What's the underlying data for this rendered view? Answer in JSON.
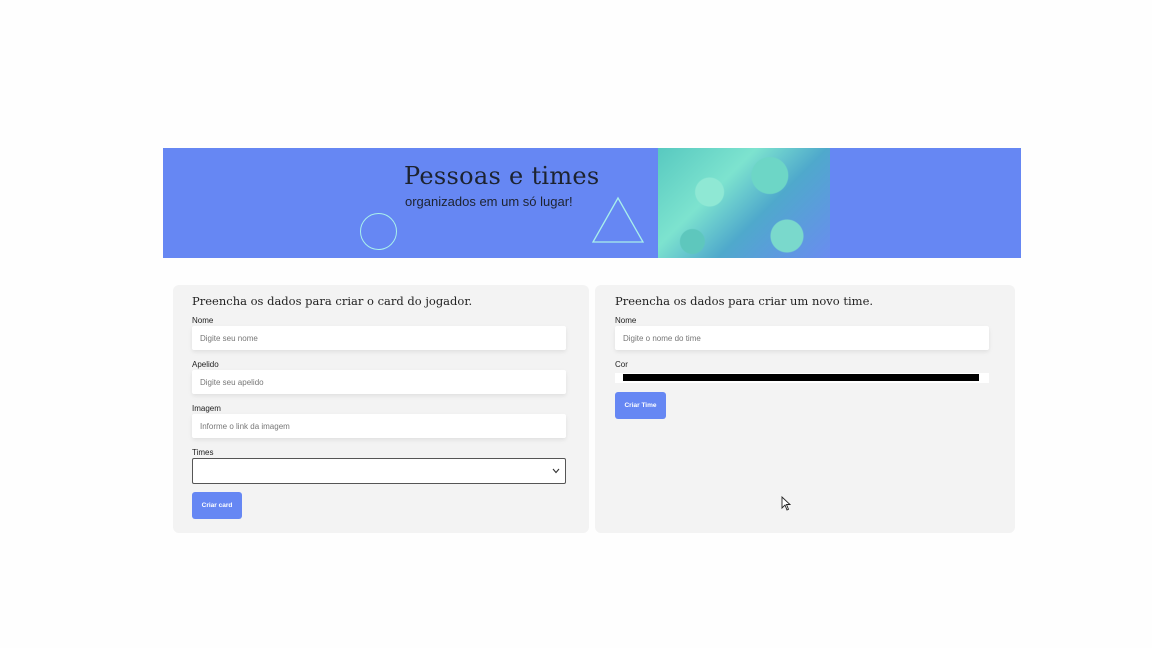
{
  "banner": {
    "title": "Pessoas e times",
    "subtitle": "organizados em um só lugar!",
    "colors": {
      "background": "#6687f3",
      "accent": "#a9f0ec"
    }
  },
  "player_form": {
    "title": "Preencha os dados para criar o card do jogador.",
    "name_label": "Nome",
    "name_placeholder": "Digite seu nome",
    "nickname_label": "Apelido",
    "nickname_placeholder": "Digite seu apelido",
    "image_label": "Imagem",
    "image_placeholder": "Informe o link da imagem",
    "teams_label": "Times",
    "teams_selected": "",
    "submit_label": "Criar card"
  },
  "team_form": {
    "title": "Preencha os dados para criar um novo time.",
    "name_label": "Nome",
    "name_placeholder": "Digite o nome do time",
    "color_label": "Cor",
    "color_value": "#000000",
    "submit_label": "Criar Time"
  },
  "icons": {
    "select_chevron": "chevron-down-icon",
    "cursor": "mouse-pointer-icon"
  }
}
